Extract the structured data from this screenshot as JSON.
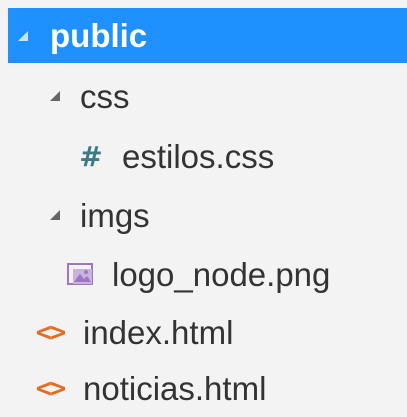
{
  "explorer": {
    "items": [
      {
        "label": "public",
        "icon": "caret-down-icon",
        "selected": true
      },
      {
        "label": "css",
        "icon": "caret-down-icon"
      },
      {
        "label": "estilos.css",
        "icon": "css-file-icon"
      },
      {
        "label": "imgs",
        "icon": "caret-down-icon"
      },
      {
        "label": "logo_node.png",
        "icon": "image-file-icon"
      },
      {
        "label": "index.html",
        "icon": "html-file-icon"
      },
      {
        "label": "noticias.html",
        "icon": "html-file-icon"
      }
    ],
    "colors": {
      "selection": "#1e90ff",
      "text": "#333333",
      "background": "#f3f3f3",
      "css_icon": "#3c7a89",
      "html_icon": "#e36c26",
      "image_icon": "#a074c4"
    },
    "glyphs": {
      "css_file": "#",
      "html_file": "<>"
    }
  }
}
